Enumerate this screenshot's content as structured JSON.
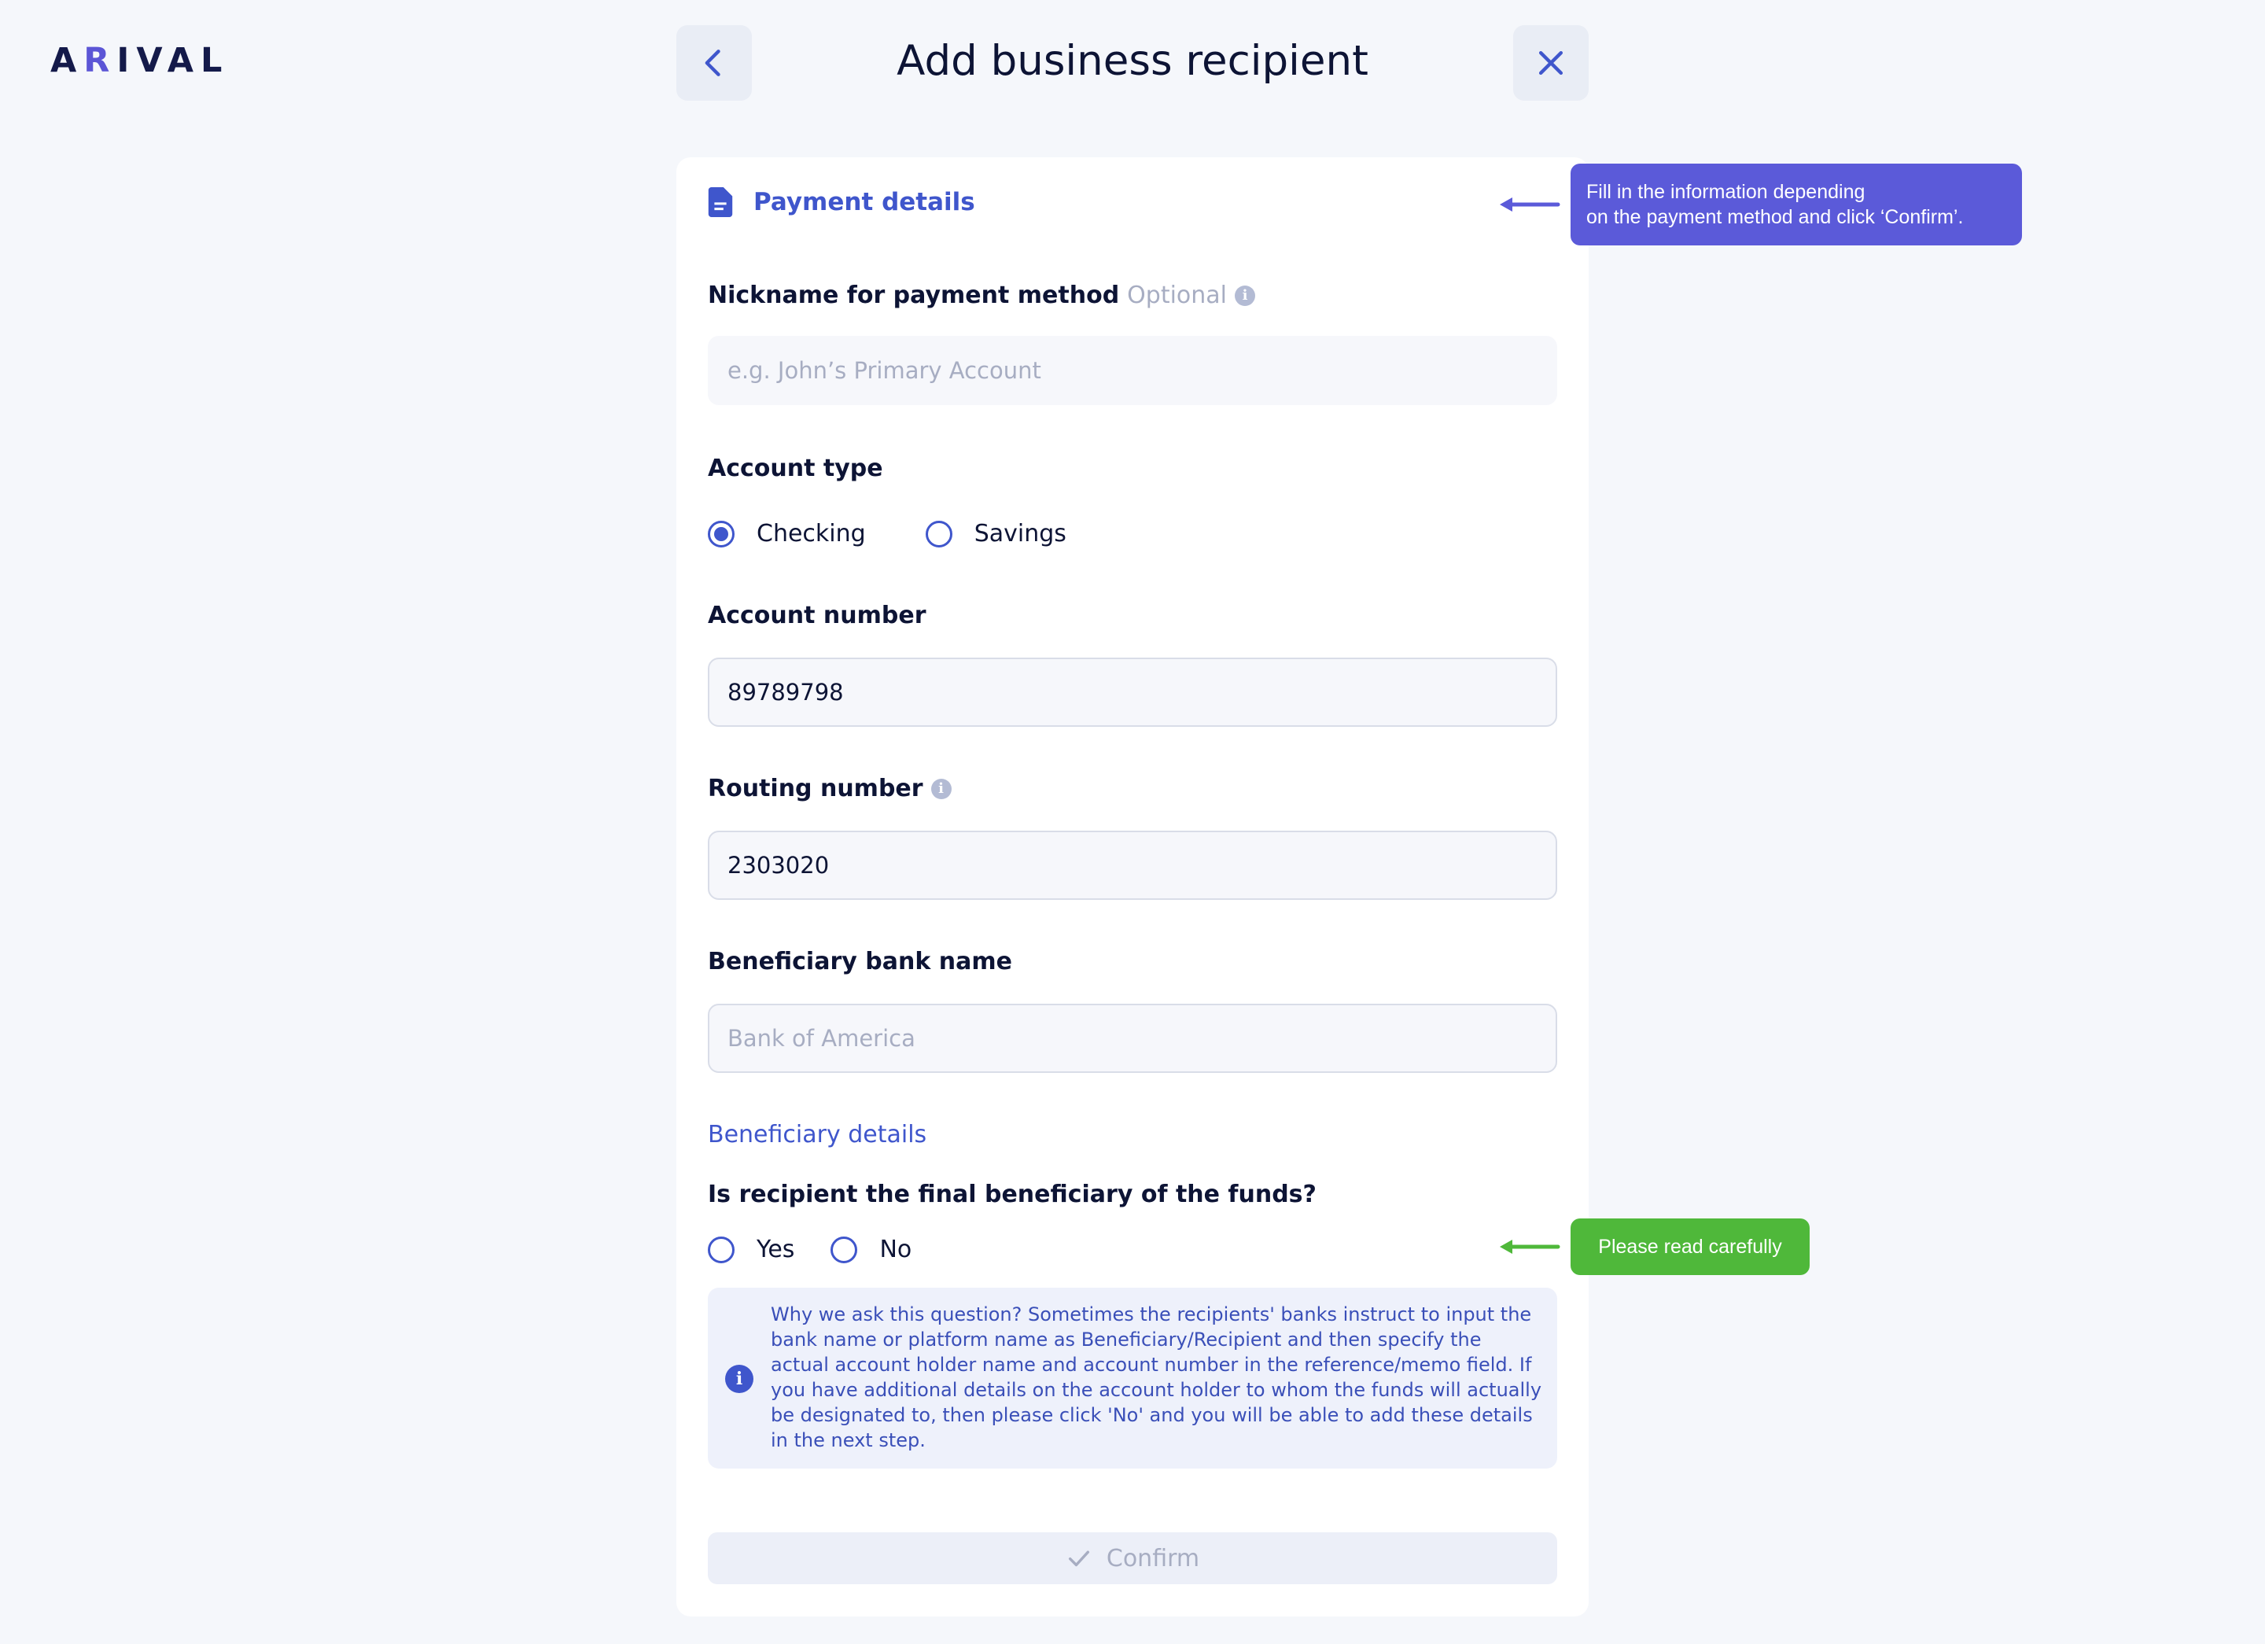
{
  "app": {
    "logo_before": "A",
    "logo_accent": "R",
    "logo_after": "IVAL",
    "title": "Add business recipient"
  },
  "colors": {
    "accent": "#3f56cc",
    "callout_blue": "#5b5ad9",
    "callout_green": "#4fb83a",
    "background": "#f5f7fb"
  },
  "icons": {
    "back": "chevron-left-icon",
    "close": "close-icon",
    "section": "document-icon",
    "info": "info-icon",
    "confirm": "check-icon"
  },
  "form": {
    "section_title": "Payment details",
    "nickname": {
      "label": "Nickname for payment method",
      "optional": "Optional",
      "placeholder": "e.g. John’s Primary Account",
      "value": ""
    },
    "account_type": {
      "label": "Account type",
      "options": [
        "Checking",
        "Savings"
      ],
      "selected": "Checking"
    },
    "account_number": {
      "label": "Account number",
      "value": "89789798"
    },
    "routing_number": {
      "label": "Routing number",
      "value": "2303020"
    },
    "bank_name": {
      "label": "Beneficiary bank name",
      "placeholder": "Bank of America",
      "value": ""
    },
    "beneficiary_details_link": "Beneficiary details",
    "final_beneficiary": {
      "question": "Is recipient the final beneficiary of the funds?",
      "options": [
        "Yes",
        "No"
      ],
      "selected": null
    },
    "notice": "Why we ask this question? Sometimes the recipients' banks instruct to input the bank name or platform name as Beneficiary/Recipient and then specify the actual account holder name and account number in the reference/memo field. If you have additional details on the account holder to whom the funds will actually be designated to, then please click 'No' and you will be able to add these details in the next step.",
    "confirm_label": "Confirm"
  },
  "callouts": {
    "top_line1": "Fill in the information depending",
    "top_line2": "on the payment method and click ‘Confirm’.",
    "bottom": "Please read carefully"
  }
}
